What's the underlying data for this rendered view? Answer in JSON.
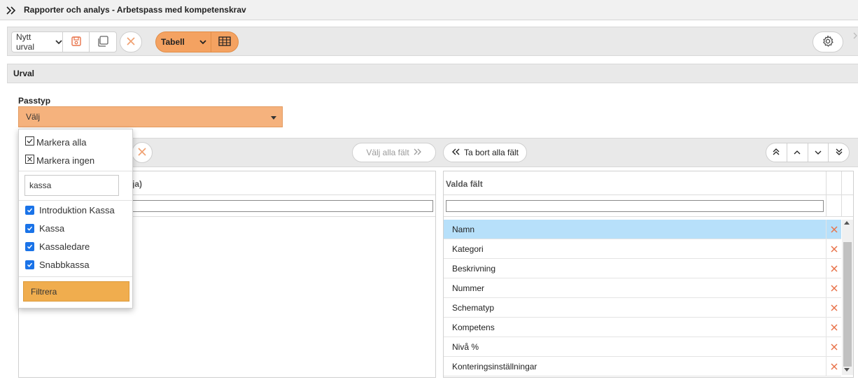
{
  "header": {
    "title": "Rapporter och analys - Arbetspass med kompetenskrav"
  },
  "toolbar": {
    "selection_value": "Nytt urval",
    "view_value": "Tabell"
  },
  "urval": {
    "title": "Urval",
    "passtyp_label": "Passtyp",
    "passtyp_value": "Välj"
  },
  "dropdown": {
    "select_all": "Markera alla",
    "select_none": "Markera ingen",
    "search_value": "kassa",
    "options": [
      {
        "label": "Introduktion Kassa",
        "checked": true
      },
      {
        "label": "Kassa",
        "checked": true
      },
      {
        "label": "Kassaledare",
        "checked": true
      },
      {
        "label": "Snabbkassa",
        "checked": true
      }
    ],
    "filter_label": "Filtrera"
  },
  "fields": {
    "select_all_label": "Välj alla fält",
    "remove_all_label": "Ta bort alla fält",
    "left_header_partial": "ja)",
    "right_header": "Valda fält",
    "selected": [
      "Namn",
      "Kategori",
      "Beskrivning",
      "Nummer",
      "Schematyp",
      "Kompetens",
      "Nivå %",
      "Konteringsinställningar"
    ]
  },
  "colors": {
    "accent": "#f4a261",
    "filter_button": "#f0ad4e",
    "selected_row": "#b7e0fa",
    "remove_x": "#e8734a"
  }
}
